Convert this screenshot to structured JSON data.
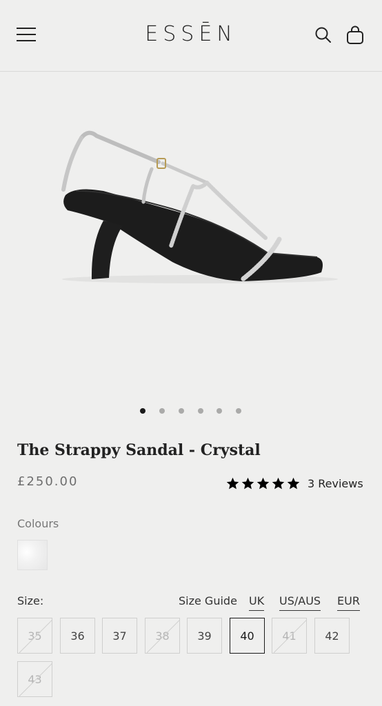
{
  "header": {
    "logo": "ESSĒN",
    "menu_icon": "hamburger-menu-icon",
    "search_icon": "search-icon",
    "bag_icon": "shopping-bag-icon"
  },
  "gallery": {
    "image_alt": "Strappy sandal product photo",
    "slide_count": 6,
    "active_slide": 1
  },
  "product": {
    "title": "The Strappy Sandal - Crystal",
    "price": "£250.00",
    "rating": 5,
    "reviews_label": "3 Reviews"
  },
  "colours": {
    "label": "Colours",
    "swatch_color": "#ececec"
  },
  "size": {
    "label": "Size:",
    "guide_label": "Size Guide",
    "units": [
      "UK",
      "US/AUS",
      "EUR"
    ],
    "options": [
      {
        "value": "35",
        "available": false,
        "selected": false
      },
      {
        "value": "36",
        "available": true,
        "selected": false
      },
      {
        "value": "37",
        "available": true,
        "selected": false
      },
      {
        "value": "38",
        "available": false,
        "selected": false
      },
      {
        "value": "39",
        "available": true,
        "selected": false
      },
      {
        "value": "40",
        "available": true,
        "selected": true
      },
      {
        "value": "41",
        "available": false,
        "selected": false
      },
      {
        "value": "42",
        "available": true,
        "selected": false
      },
      {
        "value": "43",
        "available": false,
        "selected": false
      }
    ]
  },
  "colors": {
    "background": "#efefee",
    "text": "#1a1a1a",
    "muted": "#6e6e6e",
    "border": "#cfcfce"
  }
}
